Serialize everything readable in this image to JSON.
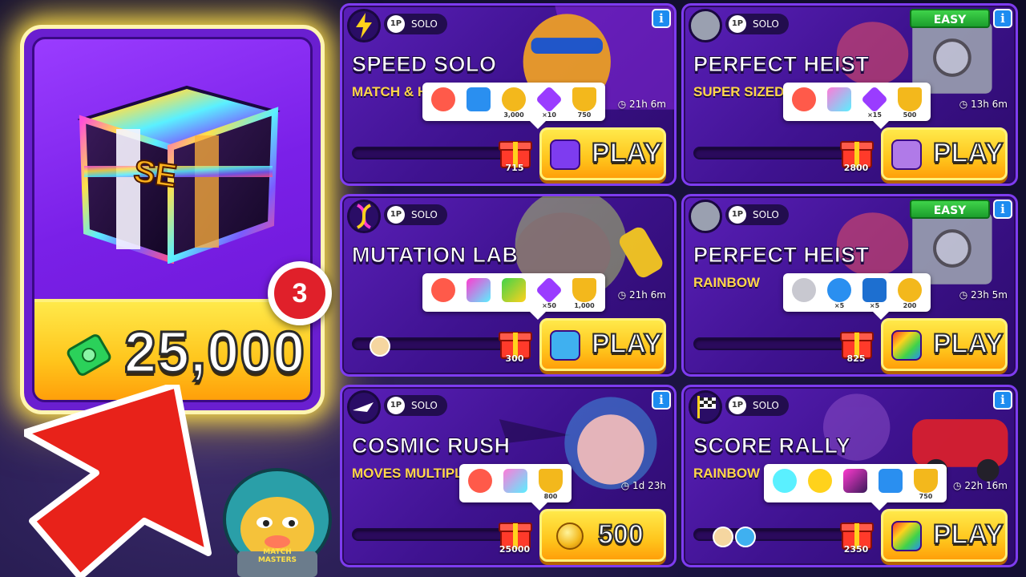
{
  "chest": {
    "label": "SE",
    "price": "25,000",
    "badge_count": "3"
  },
  "events": [
    {
      "id": "speed-solo",
      "title": "SPEED SOLO",
      "subtitle": "MATCH & H",
      "mode": "SOLO",
      "players": "1P",
      "timer": "21h 6m",
      "easy": "",
      "rewards": [
        {
          "icon": "mystery-card-icon",
          "count": ""
        },
        {
          "icon": "blue-chest-icon",
          "count": ""
        },
        {
          "icon": "coins-pile-icon",
          "count": "3,000"
        },
        {
          "icon": "purple-gem-icon",
          "count": "×10"
        },
        {
          "icon": "trophy-icon",
          "count": "750"
        }
      ],
      "gift_count": "715",
      "action": "PLAY",
      "progress": 0
    },
    {
      "id": "perfect-heist-1",
      "title": "PERFECT HEIST",
      "subtitle": "SUPER SIZED",
      "mode": "SOLO",
      "players": "1P",
      "timer": "13h 6m",
      "easy": "EASY",
      "rewards": [
        {
          "icon": "mystery-card-icon",
          "count": ""
        },
        {
          "icon": "se-card-icon",
          "count": ""
        },
        {
          "icon": "purple-gem-icon",
          "count": "×15"
        },
        {
          "icon": "trophy-icon",
          "count": "500"
        }
      ],
      "gift_count": "2800",
      "action": "PLAY",
      "progress": 0
    },
    {
      "id": "mutation-lab",
      "title": "MUTATION LAB",
      "subtitle": "",
      "mode": "SOLO",
      "players": "1P",
      "timer": "21h 6m",
      "easy": "",
      "rewards": [
        {
          "icon": "mystery-card-icon",
          "count": ""
        },
        {
          "icon": "legendary-card-icon",
          "count": ""
        },
        {
          "icon": "character-card-icon",
          "count": ""
        },
        {
          "icon": "purple-gem-icon",
          "count": "×50"
        },
        {
          "icon": "trophy-icon",
          "count": "1,000"
        }
      ],
      "gift_count": "300",
      "action": "PLAY",
      "progress": 0
    },
    {
      "id": "perfect-heist-2",
      "title": "PERFECT HEIST",
      "subtitle": "RAINBOW",
      "mode": "SOLO",
      "players": "1P",
      "timer": "23h 5m",
      "easy": "EASY",
      "rewards": [
        {
          "icon": "mystery-card-icon",
          "count": ""
        },
        {
          "icon": "blue-token-icon",
          "count": "×5"
        },
        {
          "icon": "blue-booster-icon",
          "count": "×5"
        },
        {
          "icon": "coins-pile-icon",
          "count": "200"
        }
      ],
      "gift_count": "825",
      "action": "PLAY",
      "progress": 0
    },
    {
      "id": "cosmic-rush",
      "title": "COSMIC RUSH",
      "subtitle": "MOVES MULTIPLI",
      "mode": "SOLO",
      "players": "1P",
      "timer": "1d 23h",
      "easy": "",
      "rewards": [
        {
          "icon": "mystery-card-icon",
          "count": ""
        },
        {
          "icon": "se-card-icon",
          "count": ""
        },
        {
          "icon": "trophy-icon",
          "count": "800"
        }
      ],
      "gift_count": "25000",
      "action": "500",
      "progress": 0
    },
    {
      "id": "score-rally",
      "title": "SCORE RALLY",
      "subtitle": "RAINBOW",
      "mode": "SOLO",
      "players": "1P",
      "timer": "22h 16m",
      "easy": "",
      "rewards": [
        {
          "icon": "mystery-card-icon",
          "count": ""
        },
        {
          "icon": "gold-mystery-icon",
          "count": ""
        },
        {
          "icon": "legendary-card-icon",
          "count": ""
        },
        {
          "icon": "shield-card-icon",
          "count": ""
        },
        {
          "icon": "trophy-icon",
          "count": "750"
        }
      ],
      "gift_count": "2350",
      "action": "PLAY",
      "progress": 0
    }
  ],
  "mascot_label": "MATCH MASTERS",
  "colors": {
    "accent_yellow": "#ffc51c",
    "card_purple": "#5a1fb8",
    "badge_red": "#e0202a",
    "easy_green": "#1c9e2c",
    "info_blue": "#1d8cf0",
    "arrow_red": "#e8221a"
  }
}
